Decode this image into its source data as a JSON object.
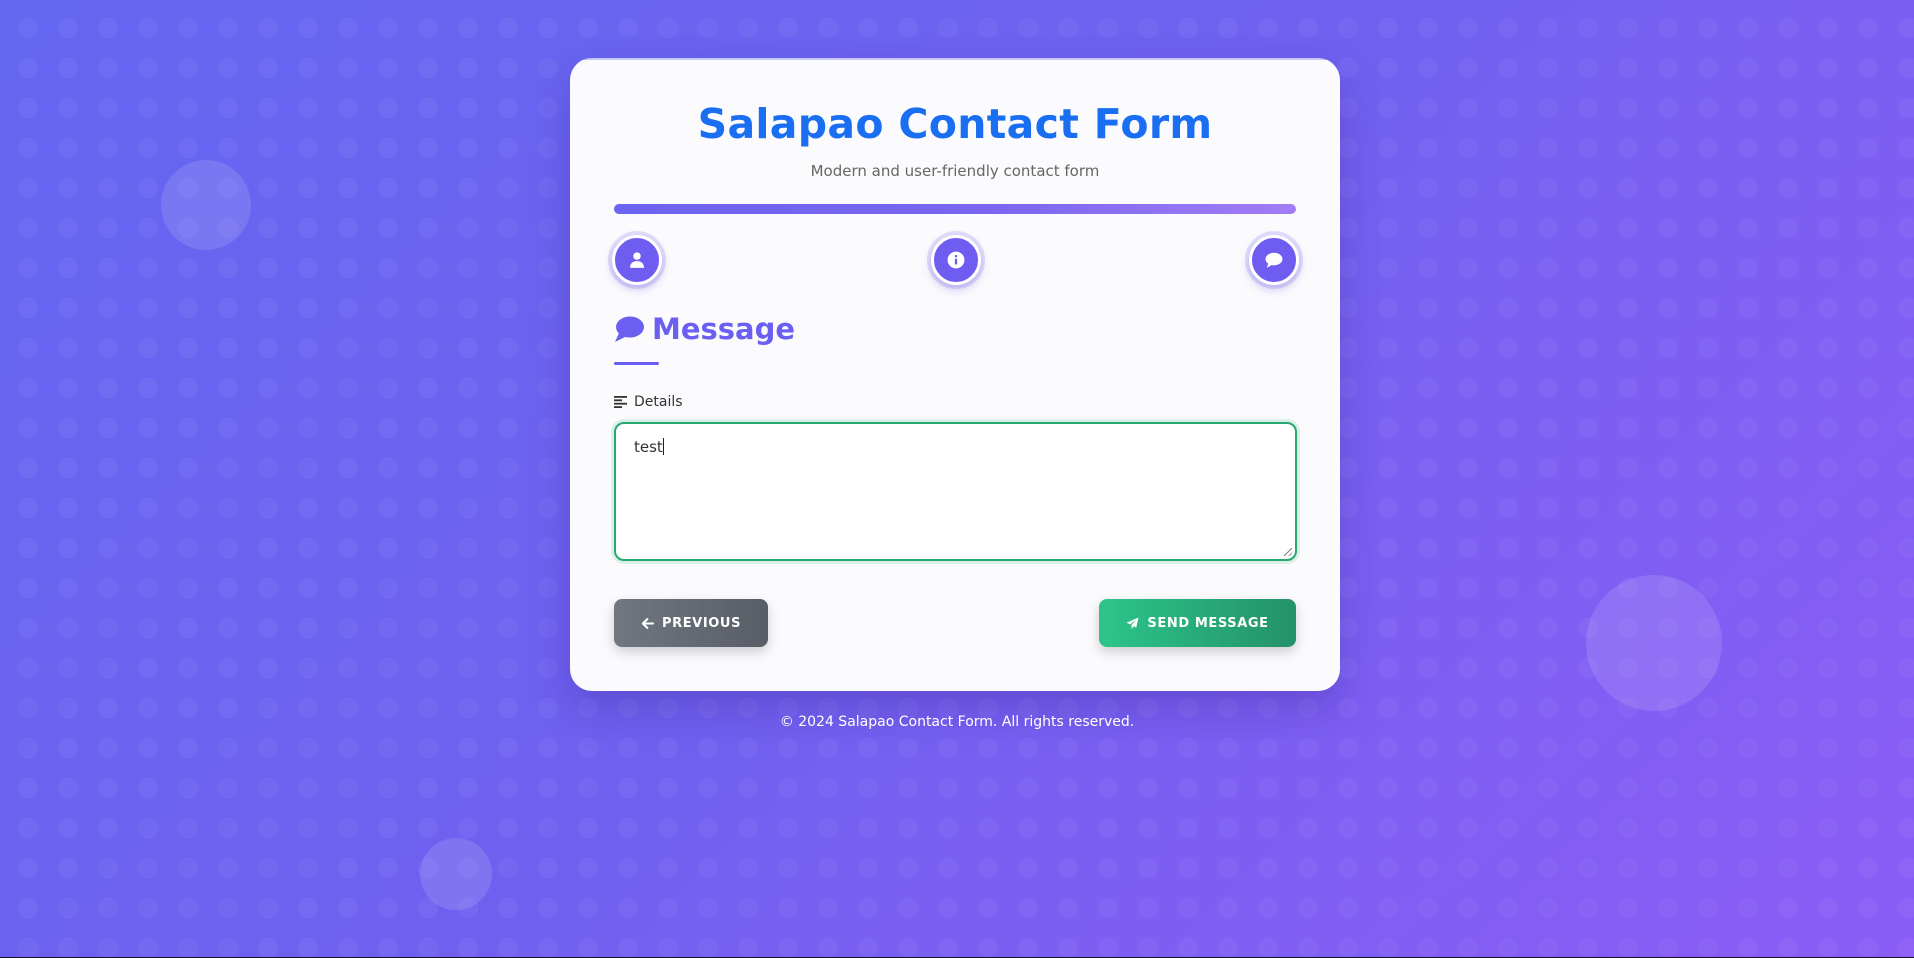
{
  "app": {
    "title": "Salapao Contact Form",
    "subtitle": "Modern and user-friendly contact form"
  },
  "progress": {
    "current_step": 3,
    "total_steps": 3,
    "fraction": 1.0,
    "steps": [
      {
        "icon": "user-icon"
      },
      {
        "icon": "info-icon"
      },
      {
        "icon": "comment-icon"
      }
    ]
  },
  "section": {
    "icon": "comment-icon",
    "heading": "Message"
  },
  "details": {
    "icon": "align-left-icon",
    "label": "Details",
    "value": "test"
  },
  "buttons": {
    "previous_label": "PREVIOUS",
    "previous_icon": "arrow-left-icon",
    "send_label": "SEND MESSAGE",
    "send_icon": "paper-plane-icon"
  },
  "footer": {
    "text": "© 2024 Salapao Contact Form. All rights reserved."
  },
  "colors": {
    "title": "#1a6ef2",
    "accent": "#6a5ff0",
    "success": "#27a86e",
    "neutral_button": "#6b7079"
  }
}
